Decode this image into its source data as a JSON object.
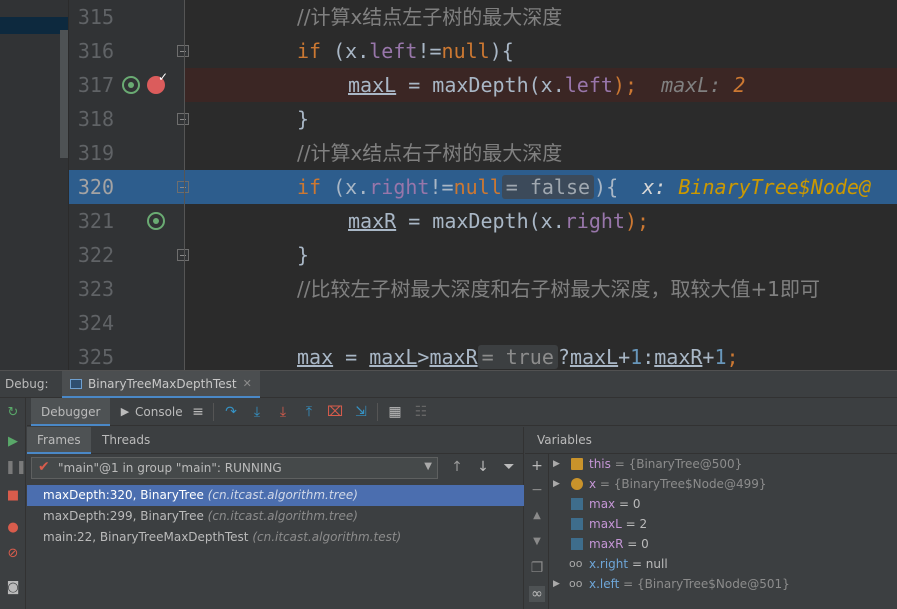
{
  "editor": {
    "lines": [
      {
        "num": "315"
      },
      {
        "num": "316"
      },
      {
        "num": "317"
      },
      {
        "num": "318"
      },
      {
        "num": "319"
      },
      {
        "num": "320"
      },
      {
        "num": "321"
      },
      {
        "num": "322"
      },
      {
        "num": "323"
      },
      {
        "num": "324"
      },
      {
        "num": "325"
      }
    ],
    "code": {
      "l315_comment": "//计算x结点左子树的最大深度",
      "l316_if": "if",
      "l316_a": " (x.",
      "l316_field": "left",
      "l316_b": "!=",
      "l316_null": "null",
      "l316_c": "){",
      "l317_var": "maxL",
      "l317_a": " = maxDepth(x.",
      "l317_field": "left",
      "l317_b": ");",
      "l317_hint_name": "maxL: ",
      "l317_hint_val": "2",
      "l318_brace": "}",
      "l319_comment": "//计算x结点右子树的最大深度",
      "l320_if": "if",
      "l320_a": " (x.",
      "l320_field": "right",
      "l320_b": "!=",
      "l320_null": "null",
      "l320_hint": "= false",
      "l320_c": "){",
      "l320_obj_name": "x: ",
      "l320_obj_val": "BinaryTree$Node@",
      "l321_var": "maxR",
      "l321_a": " = maxDepth(x.",
      "l321_field": "right",
      "l321_b": ");",
      "l322_brace": "}",
      "l323_comment": "//比较左子树最大深度和右子树最大深度，取较大值+1即可",
      "l325_max": "max",
      "l325_a": " = ",
      "l325_maxL": "maxL",
      "l325_gt": ">",
      "l325_maxR": "maxR",
      "l325_hint": "= true",
      "l325_q": "?",
      "l325_maxL2": "maxL",
      "l325_plus1": "+",
      "l325_one1": "1",
      "l325_colon": ":",
      "l325_maxR2": "maxR",
      "l325_plus2": "+",
      "l325_one2": "1",
      "l325_semi": ";"
    }
  },
  "debug": {
    "label": "Debug:",
    "session_tab": "BinaryTreeMaxDepthTest",
    "tabs": {
      "debugger": "Debugger",
      "console": "Console"
    },
    "frames_tabs": {
      "frames": "Frames",
      "threads": "Threads"
    },
    "thread": "\"main\"@1 in group \"main\": RUNNING",
    "frames": [
      {
        "method": "maxDepth:320, BinaryTree",
        "pkg": "(cn.itcast.algorithm.tree)"
      },
      {
        "method": "maxDepth:299, BinaryTree",
        "pkg": "(cn.itcast.algorithm.tree)"
      },
      {
        "method": "main:22, BinaryTreeMaxDepthTest",
        "pkg": "(cn.itcast.algorithm.test)"
      }
    ],
    "variables_header": "Variables",
    "variables": [
      {
        "name": "this",
        "value": " = {BinaryTree@500}"
      },
      {
        "name": "x",
        "value": " = {BinaryTree$Node@499}"
      },
      {
        "name": "max",
        "value": " = 0"
      },
      {
        "name": "maxL",
        "value": " = 2"
      },
      {
        "name": "maxR",
        "value": " = 0"
      },
      {
        "name": "x.right",
        "value": " = null"
      },
      {
        "name": "x.left",
        "value": " = {BinaryTree$Node@501}"
      }
    ]
  },
  "colors": {
    "editor_bg": "#2b2b2b",
    "current_line": "#2d5d8d",
    "breakpoint_line": "#3b2624",
    "keyword": "#cc7832",
    "field": "#9876aa",
    "comment": "#808080",
    "selection": "#4b6eaf"
  }
}
